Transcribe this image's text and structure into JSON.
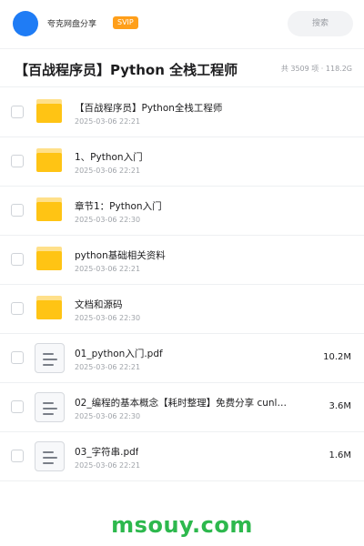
{
  "header": {
    "username": "夸克网盘分享",
    "badge": "SVIP",
    "search_placeholder": "搜索",
    "accent_color": "#1f7cf5",
    "badge_color": "#ff9f1a"
  },
  "folder": {
    "title": "【百战程序员】Python 全栈工程师",
    "meta": "共 3509 项 · 118.2G"
  },
  "items": [
    {
      "type": "folder",
      "icon": "folder-icon",
      "name": "【百战程序员】Python全栈工程师",
      "date": "2025-03-06 22:21",
      "size": ""
    },
    {
      "type": "folder",
      "icon": "folder-icon",
      "name": "1、Python入门",
      "date": "2025-03-06 22:21",
      "size": ""
    },
    {
      "type": "folder",
      "icon": "folder-icon",
      "name": "章节1：Python入门",
      "date": "2025-03-06 22:30",
      "size": ""
    },
    {
      "type": "folder",
      "icon": "folder-icon",
      "name": "python基础相关资料",
      "date": "2025-03-06 22:21",
      "size": ""
    },
    {
      "type": "folder",
      "icon": "folder-icon",
      "name": "文档和源码",
      "date": "2025-03-06 22:30",
      "size": ""
    },
    {
      "type": "file",
      "icon": "document-icon",
      "name": "01_python入门.pdf",
      "date": "2025-03-06 22:21",
      "size": "10.2M"
    },
    {
      "type": "file",
      "icon": "document-icon",
      "name": "02_编程的基本概念【耗时整理】免费分享 cunl…",
      "date": "2025-03-06 22:30",
      "size": "3.6M"
    },
    {
      "type": "file",
      "icon": "document-icon",
      "name": "03_字符串.pdf",
      "date": "2025-03-06 22:21",
      "size": "1.6M"
    }
  ],
  "watermark": "msouy.com"
}
